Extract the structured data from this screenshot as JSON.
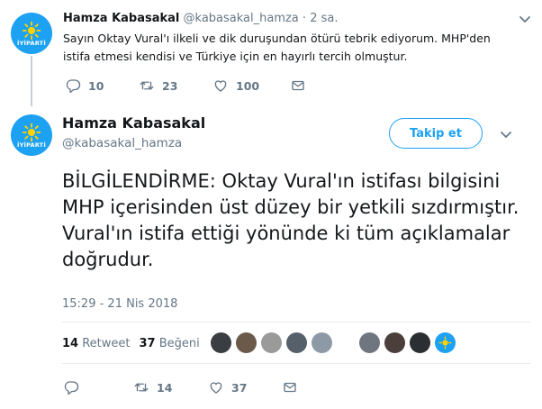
{
  "colors": {
    "brand": "#1da1f2",
    "muted": "#657786",
    "text": "#14171a",
    "like_red": "#e0245e",
    "retweet_green": "#17bf63"
  },
  "reply_tweet": {
    "name": "Hamza Kabasakal",
    "handle": "@kabasakal_hamza",
    "separator": "·",
    "time": "2 sa.",
    "text": "Sayın Oktay Vural'ı ilkeli ve dik duruşundan ötürü tebrik ediyorum. MHP'den istifa etmesi kendisi ve Türkiye için en hayırlı tercih olmuştur.",
    "replies": "10",
    "retweets": "23",
    "likes": "100",
    "icons": [
      "reply-icon",
      "retweet-icon",
      "like-icon",
      "message-icon",
      "chevron-down-icon"
    ]
  },
  "avatar_brand": "İYİPARTİ",
  "main_tweet": {
    "name": "Hamza Kabasakal",
    "handle": "@kabasakal_hamza",
    "follow_label": "Takip et",
    "text": "BİLGİLENDİRME: Oktay Vural'ın istifası bilgisini MHP içerisinden üst düzey bir yetkili sızdırmıştır. Vural'ın istifa ettiği yönünde ki tüm açıklamalar doğrudur.",
    "timestamp": "15:29 - 21 Nis 2018",
    "retweet_count": "14",
    "retweet_label": "Retweet",
    "like_count": "37",
    "like_label": "Beğeni",
    "action_retweets": "14",
    "action_likes": "37",
    "liker_avatars": 9
  }
}
